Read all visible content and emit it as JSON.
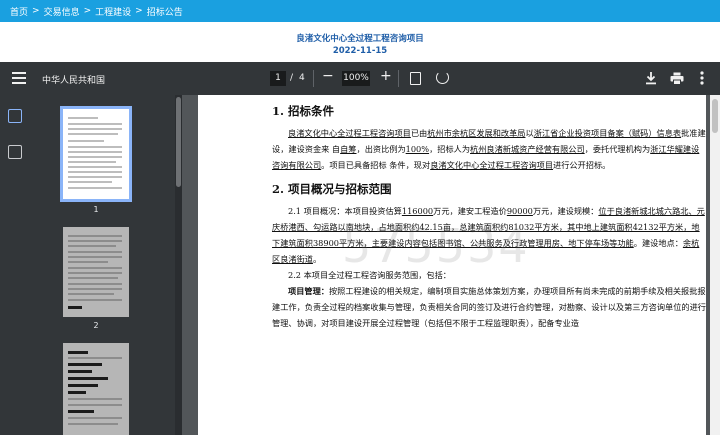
{
  "breadcrumb": {
    "items": [
      "首页",
      "交易信息",
      "工程建设",
      "招标公告"
    ],
    "separator": ">"
  },
  "header": {
    "title": "良渚文化中心全过程工程咨询项目",
    "date": "2022-11-15"
  },
  "toolbar": {
    "doc_title": "中华人民共和国",
    "current_page": "1",
    "page_separator": "/",
    "total_pages": "4",
    "zoom": "100%",
    "zoom_out": "−",
    "zoom_in": "+"
  },
  "thumbnails": [
    {
      "label": "1",
      "selected": true
    },
    {
      "label": "2",
      "selected": false
    },
    {
      "label": "",
      "selected": false
    }
  ],
  "document": {
    "watermark": "575534",
    "section1_heading": "1. 招标条件",
    "section1_para_a": "良渚文化中心全过程工程咨询项目",
    "section1_para_b": "已由",
    "section1_para_c": "杭州市余杭区发展和改革局",
    "section1_para_d": "以",
    "section1_para_e": "浙江省企业投资项目备案（赋码）信息表",
    "section1_para_f": "批准建设，建设资金来 自",
    "section1_para_g": "自筹",
    "section1_para_h": "，出资比例为",
    "section1_para_i": "100%",
    "section1_para_j": "，招标人为",
    "section1_para_k": "杭州良渚新城资产经营有限公司",
    "section1_para_l": "，委托代理机构为",
    "section1_para_m": "浙江华耀建设咨询有限公司",
    "section1_para_n": "。项目已具备招标 条件，现对",
    "section1_para_o": "良渚文化中心全过程工程咨询项目",
    "section1_para_p": "进行公开招标。",
    "section2_heading": "2. 项目概况与招标范围",
    "s21_a": "2.1 项目概况：本项目投资估算",
    "s21_b": "116000",
    "s21_c": "万元，建安工程造价",
    "s21_d": "90000",
    "s21_e": "万元，建设规模：",
    "s21_f": "位于良渚新城北城六路北、元庆桥港西、勾运路以南地块，占地面积约42.15亩，总建筑面积约81032平方米，其中地上建筑面积42132平方米，地下建筑面积38900平方米，主要建设内容包括图书馆、公共服务及行政管理用房、地下停车场等功能",
    "s21_g": "。建设地点：",
    "s21_h": "余杭区良渚街道",
    "s21_i": "。",
    "s22": "2.2 本项目全过程工程咨询服务范围，包括：",
    "mgmt_label": "项目管理：",
    "mgmt_text": "按照工程建设的相关规定，编制项目实施总体策划方案，办理项目所有尚未完成的前期手续及相关报批报建工作，负责全过程的档案收集与管理，负责相关合同的签订及进行合约管理，对勘察、设计以及第三方咨询单位的进行管理、协调，对项目建设开展全过程管理（包括但不限于工程监理职责），配备专业造"
  }
}
